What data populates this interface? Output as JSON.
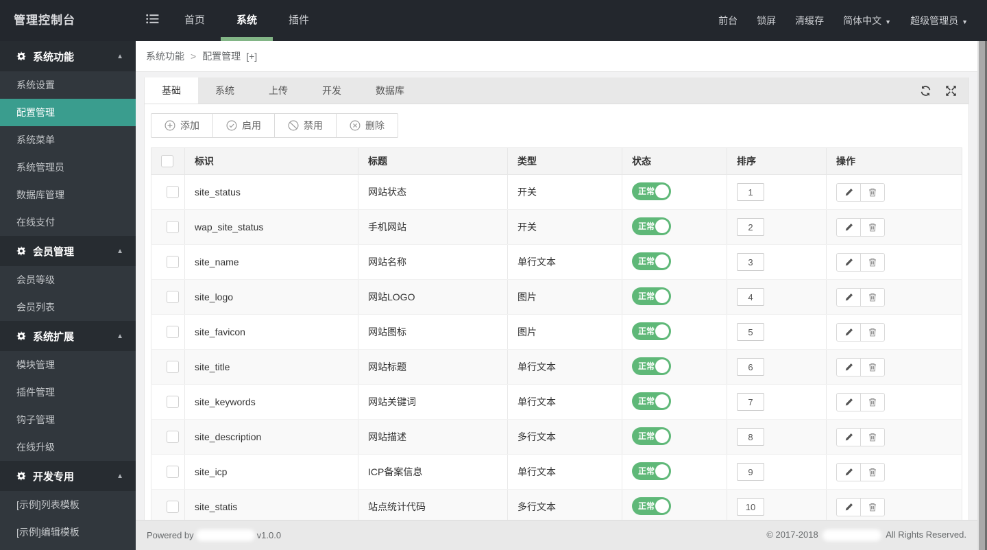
{
  "colors": {
    "topbar_bg": "#23272D",
    "sidebar_bg": "#31373D",
    "accent_underline_green": "#82B586",
    "active_item_teal": "#3A9D8E",
    "toggle_green": "#5FB878"
  },
  "topbar": {
    "brand": "管理控制台",
    "nav": [
      {
        "label": "首页",
        "active": false
      },
      {
        "label": "系统",
        "active": true
      },
      {
        "label": "插件",
        "active": false
      }
    ],
    "quick_links": [
      "前台",
      "锁屏",
      "清缓存"
    ],
    "language": {
      "label": "简体中文",
      "caret": "▼"
    },
    "user": {
      "label": "超级管理员",
      "caret": "▼"
    }
  },
  "sidebar": {
    "sections": [
      {
        "title": "系统功能",
        "caret": "▲",
        "items": [
          {
            "label": "系统设置",
            "active": false
          },
          {
            "label": "配置管理",
            "active": true
          },
          {
            "label": "系统菜单",
            "active": false
          },
          {
            "label": "系统管理员",
            "active": false
          },
          {
            "label": "数据库管理",
            "active": false
          },
          {
            "label": "在线支付",
            "active": false
          }
        ]
      },
      {
        "title": "会员管理",
        "caret": "▲",
        "items": [
          {
            "label": "会员等级",
            "active": false
          },
          {
            "label": "会员列表",
            "active": false
          }
        ]
      },
      {
        "title": "系统扩展",
        "caret": "▲",
        "items": [
          {
            "label": "模块管理",
            "active": false
          },
          {
            "label": "插件管理",
            "active": false
          },
          {
            "label": "钩子管理",
            "active": false
          },
          {
            "label": "在线升级",
            "active": false
          }
        ]
      },
      {
        "title": "开发专用",
        "caret": "▲",
        "items": [
          {
            "label": "[示例]列表模板",
            "active": false
          },
          {
            "label": "[示例]编辑模板",
            "active": false
          }
        ]
      }
    ]
  },
  "breadcrumb": {
    "section": "系统功能",
    "separator": ">",
    "page": "配置管理",
    "new_tab": "[+]"
  },
  "tabs": [
    {
      "label": "基础",
      "active": true
    },
    {
      "label": "系统",
      "active": false
    },
    {
      "label": "上传",
      "active": false
    },
    {
      "label": "开发",
      "active": false
    },
    {
      "label": "数据库",
      "active": false
    }
  ],
  "toolbar": {
    "buttons": [
      {
        "label": "添加",
        "icon": "plus-circle-icon"
      },
      {
        "label": "启用",
        "icon": "check-circle-icon"
      },
      {
        "label": "禁用",
        "icon": "ban-circle-icon"
      },
      {
        "label": "删除",
        "icon": "close-circle-icon"
      }
    ]
  },
  "table": {
    "columns": [
      "标识",
      "标题",
      "类型",
      "状态",
      "排序",
      "操作"
    ],
    "rows": [
      {
        "id": "site_status",
        "title": "网站状态",
        "type": "开关",
        "status": "正常",
        "status_on": true,
        "sort": "1"
      },
      {
        "id": "wap_site_status",
        "title": "手机网站",
        "type": "开关",
        "status": "正常",
        "status_on": true,
        "sort": "2"
      },
      {
        "id": "site_name",
        "title": "网站名称",
        "type": "单行文本",
        "status": "正常",
        "status_on": true,
        "sort": "3"
      },
      {
        "id": "site_logo",
        "title": "网站LOGO",
        "type": "图片",
        "status": "正常",
        "status_on": true,
        "sort": "4"
      },
      {
        "id": "site_favicon",
        "title": "网站图标",
        "type": "图片",
        "status": "正常",
        "status_on": true,
        "sort": "5"
      },
      {
        "id": "site_title",
        "title": "网站标题",
        "type": "单行文本",
        "status": "正常",
        "status_on": true,
        "sort": "6"
      },
      {
        "id": "site_keywords",
        "title": "网站关键词",
        "type": "单行文本",
        "status": "正常",
        "status_on": true,
        "sort": "7"
      },
      {
        "id": "site_description",
        "title": "网站描述",
        "type": "多行文本",
        "status": "正常",
        "status_on": true,
        "sort": "8"
      },
      {
        "id": "site_icp",
        "title": "ICP备案信息",
        "type": "单行文本",
        "status": "正常",
        "status_on": true,
        "sort": "9"
      },
      {
        "id": "site_statis",
        "title": "站点统计代码",
        "type": "多行文本",
        "status": "正常",
        "status_on": true,
        "sort": "10"
      }
    ]
  },
  "footer": {
    "left_prefix": "Powered by",
    "left_version": "v1.0.0",
    "right_prefix": "© 2017-2018",
    "right_suffix": "All Rights Reserved."
  }
}
